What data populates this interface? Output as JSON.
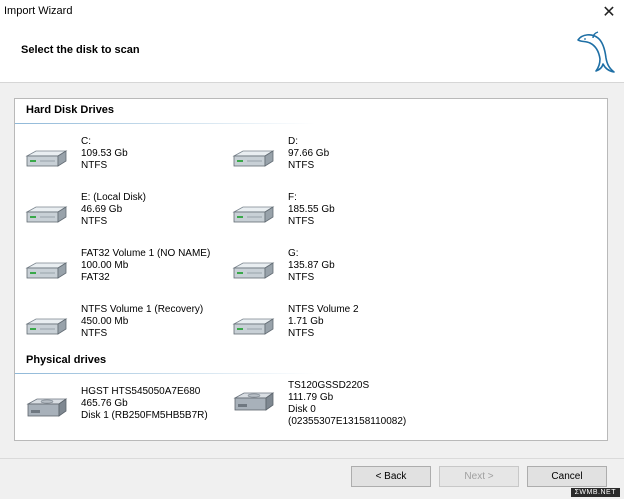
{
  "window": {
    "title": "Import Wizard",
    "close_glyph": "✕"
  },
  "header": {
    "title": "Select the disk to scan",
    "logo_icon": "dolphin-logo"
  },
  "sections": {
    "hard_disk_drives": "Hard Disk Drives",
    "physical_drives": "Physical drives"
  },
  "hard_drives": [
    {
      "lines": [
        "C:",
        "109.53 Gb",
        "NTFS"
      ]
    },
    {
      "lines": [
        "D:",
        "97.66 Gb",
        "NTFS"
      ]
    },
    {
      "lines": [
        "E: (Local Disk)",
        "46.69 Gb",
        "NTFS"
      ]
    },
    {
      "lines": [
        "F:",
        "185.55 Gb",
        "NTFS"
      ]
    },
    {
      "lines": [
        "FAT32 Volume 1 (NO NAME)",
        "100.00 Mb",
        "FAT32"
      ]
    },
    {
      "lines": [
        "G:",
        "135.87 Gb",
        "NTFS"
      ]
    },
    {
      "lines": [
        "NTFS Volume 1 (Recovery)",
        "450.00 Mb",
        "NTFS"
      ]
    },
    {
      "lines": [
        "NTFS Volume 2",
        "1.71 Gb",
        "NTFS"
      ]
    }
  ],
  "physical_drives": [
    {
      "lines": [
        "HGST HTS545050A7E680",
        "465.76 Gb",
        "Disk 1 (RB250FM5HB5B7R)"
      ]
    },
    {
      "lines": [
        "TS120GSSD220S",
        "111.79 Gb",
        "Disk 0",
        "(02355307E13158110082)"
      ]
    }
  ],
  "footer": {
    "back": "< Back",
    "next": "Next >",
    "cancel": "Cancel"
  },
  "watermark": "ΣWMB.NET",
  "colors": {
    "accent": "#1e6fa5",
    "section_line": "#8fb8d8"
  }
}
